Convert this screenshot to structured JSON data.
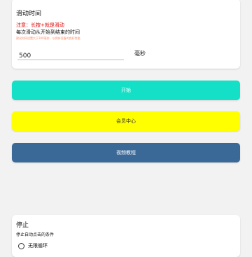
{
  "swipe_section": {
    "title": "滑动时间",
    "note": "注意：长按+就是滑动",
    "description": "每次滑动从开始到结束的时间",
    "hint": "建议时间设置大于300毫秒，以保持设备的良好性能",
    "input_value": "500",
    "unit": "毫秒"
  },
  "buttons": {
    "start": "开始",
    "vip": "会员中心",
    "video_tutorial": "视频教程"
  },
  "stop_section": {
    "title": "停止",
    "subtitle": "停止自动点击的条件",
    "option_infinite": "无限循环"
  },
  "colors": {
    "start_button": "#13e0c6",
    "vip_button": "#ffff00",
    "video_button": "#3a6897",
    "note_red": "#e00000"
  }
}
